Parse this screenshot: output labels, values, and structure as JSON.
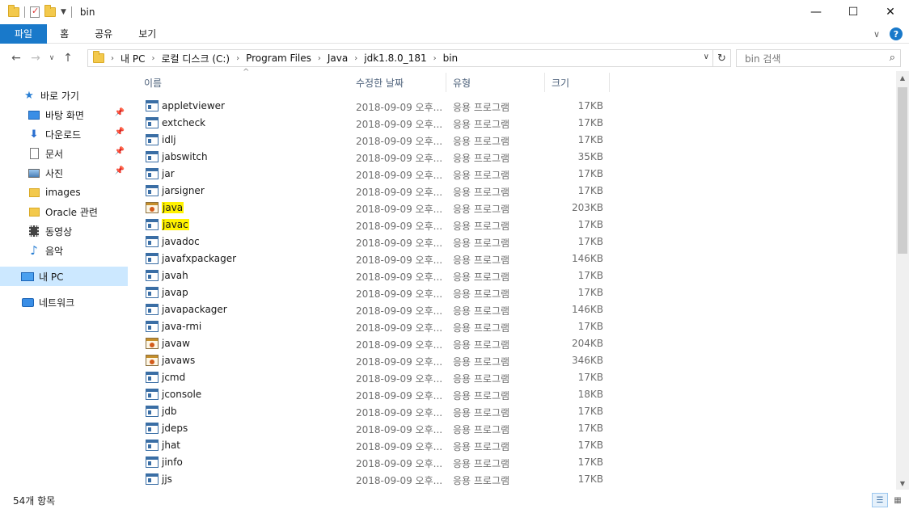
{
  "window": {
    "title": "bin",
    "minimize": "—",
    "maximize": "☐",
    "close": "✕"
  },
  "ribbon": {
    "tabs": [
      "파일",
      "홈",
      "공유",
      "보기"
    ]
  },
  "address": {
    "crumbs": [
      "내 PC",
      "로컬 디스크 (C:)",
      "Program Files",
      "Java",
      "jdk1.8.0_181",
      "bin"
    ]
  },
  "search": {
    "placeholder": "bin 검색"
  },
  "sidebar": {
    "items": [
      {
        "label": "바로 가기",
        "icon": "star-icon",
        "pinned": false
      },
      {
        "label": "바탕 화면",
        "icon": "desktop-icon",
        "pinned": true
      },
      {
        "label": "다운로드",
        "icon": "download-icon",
        "pinned": true
      },
      {
        "label": "문서",
        "icon": "documents-icon",
        "pinned": true
      },
      {
        "label": "사진",
        "icon": "pictures-icon",
        "pinned": true
      },
      {
        "label": "images",
        "icon": "folder-icon",
        "pinned": false
      },
      {
        "label": "Oracle 관련",
        "icon": "folder-icon",
        "pinned": false
      },
      {
        "label": "동영상",
        "icon": "videos-icon",
        "pinned": false
      },
      {
        "label": "음악",
        "icon": "music-icon",
        "pinned": false
      },
      {
        "label": "내 PC",
        "icon": "pc-icon",
        "pinned": false
      },
      {
        "label": "네트워크",
        "icon": "network-icon",
        "pinned": false
      }
    ]
  },
  "columns": {
    "name": "이름",
    "date": "수정한 날짜",
    "type": "유형",
    "size": "크기"
  },
  "files": [
    {
      "name": "appletviewer",
      "date": "2018-09-09 오후...",
      "type": "응용 프로그램",
      "size": "17KB",
      "icon": "app-icon",
      "highlight": false
    },
    {
      "name": "extcheck",
      "date": "2018-09-09 오후...",
      "type": "응용 프로그램",
      "size": "17KB",
      "icon": "app-icon",
      "highlight": false
    },
    {
      "name": "idlj",
      "date": "2018-09-09 오후...",
      "type": "응용 프로그램",
      "size": "17KB",
      "icon": "app-icon",
      "highlight": false
    },
    {
      "name": "jabswitch",
      "date": "2018-09-09 오후...",
      "type": "응용 프로그램",
      "size": "35KB",
      "icon": "app-icon",
      "highlight": false
    },
    {
      "name": "jar",
      "date": "2018-09-09 오후...",
      "type": "응용 프로그램",
      "size": "17KB",
      "icon": "app-icon",
      "highlight": false
    },
    {
      "name": "jarsigner",
      "date": "2018-09-09 오후...",
      "type": "응용 프로그램",
      "size": "17KB",
      "icon": "app-icon",
      "highlight": false
    },
    {
      "name": "java",
      "date": "2018-09-09 오후...",
      "type": "응용 프로그램",
      "size": "203KB",
      "icon": "java-icon",
      "highlight": true
    },
    {
      "name": "javac",
      "date": "2018-09-09 오후...",
      "type": "응용 프로그램",
      "size": "17KB",
      "icon": "app-icon",
      "highlight": true
    },
    {
      "name": "javadoc",
      "date": "2018-09-09 오후...",
      "type": "응용 프로그램",
      "size": "17KB",
      "icon": "app-icon",
      "highlight": false
    },
    {
      "name": "javafxpackager",
      "date": "2018-09-09 오후...",
      "type": "응용 프로그램",
      "size": "146KB",
      "icon": "app-icon",
      "highlight": false
    },
    {
      "name": "javah",
      "date": "2018-09-09 오후...",
      "type": "응용 프로그램",
      "size": "17KB",
      "icon": "app-icon",
      "highlight": false
    },
    {
      "name": "javap",
      "date": "2018-09-09 오후...",
      "type": "응용 프로그램",
      "size": "17KB",
      "icon": "app-icon",
      "highlight": false
    },
    {
      "name": "javapackager",
      "date": "2018-09-09 오후...",
      "type": "응용 프로그램",
      "size": "146KB",
      "icon": "app-icon",
      "highlight": false
    },
    {
      "name": "java-rmi",
      "date": "2018-09-09 오후...",
      "type": "응용 프로그램",
      "size": "17KB",
      "icon": "app-icon",
      "highlight": false
    },
    {
      "name": "javaw",
      "date": "2018-09-09 오후...",
      "type": "응용 프로그램",
      "size": "204KB",
      "icon": "java-icon",
      "highlight": false
    },
    {
      "name": "javaws",
      "date": "2018-09-09 오후...",
      "type": "응용 프로그램",
      "size": "346KB",
      "icon": "java-icon",
      "highlight": false
    },
    {
      "name": "jcmd",
      "date": "2018-09-09 오후...",
      "type": "응용 프로그램",
      "size": "17KB",
      "icon": "app-icon",
      "highlight": false
    },
    {
      "name": "jconsole",
      "date": "2018-09-09 오후...",
      "type": "응용 프로그램",
      "size": "18KB",
      "icon": "app-icon",
      "highlight": false
    },
    {
      "name": "jdb",
      "date": "2018-09-09 오후...",
      "type": "응용 프로그램",
      "size": "17KB",
      "icon": "app-icon",
      "highlight": false
    },
    {
      "name": "jdeps",
      "date": "2018-09-09 오후...",
      "type": "응용 프로그램",
      "size": "17KB",
      "icon": "app-icon",
      "highlight": false
    },
    {
      "name": "jhat",
      "date": "2018-09-09 오후...",
      "type": "응용 프로그램",
      "size": "17KB",
      "icon": "app-icon",
      "highlight": false
    },
    {
      "name": "jinfo",
      "date": "2018-09-09 오후...",
      "type": "응용 프로그램",
      "size": "17KB",
      "icon": "app-icon",
      "highlight": false
    },
    {
      "name": "jjs",
      "date": "2018-09-09 오후...",
      "type": "응용 프로그램",
      "size": "17KB",
      "icon": "app-icon",
      "highlight": false
    }
  ],
  "status": {
    "item_count": "54개 항목"
  }
}
